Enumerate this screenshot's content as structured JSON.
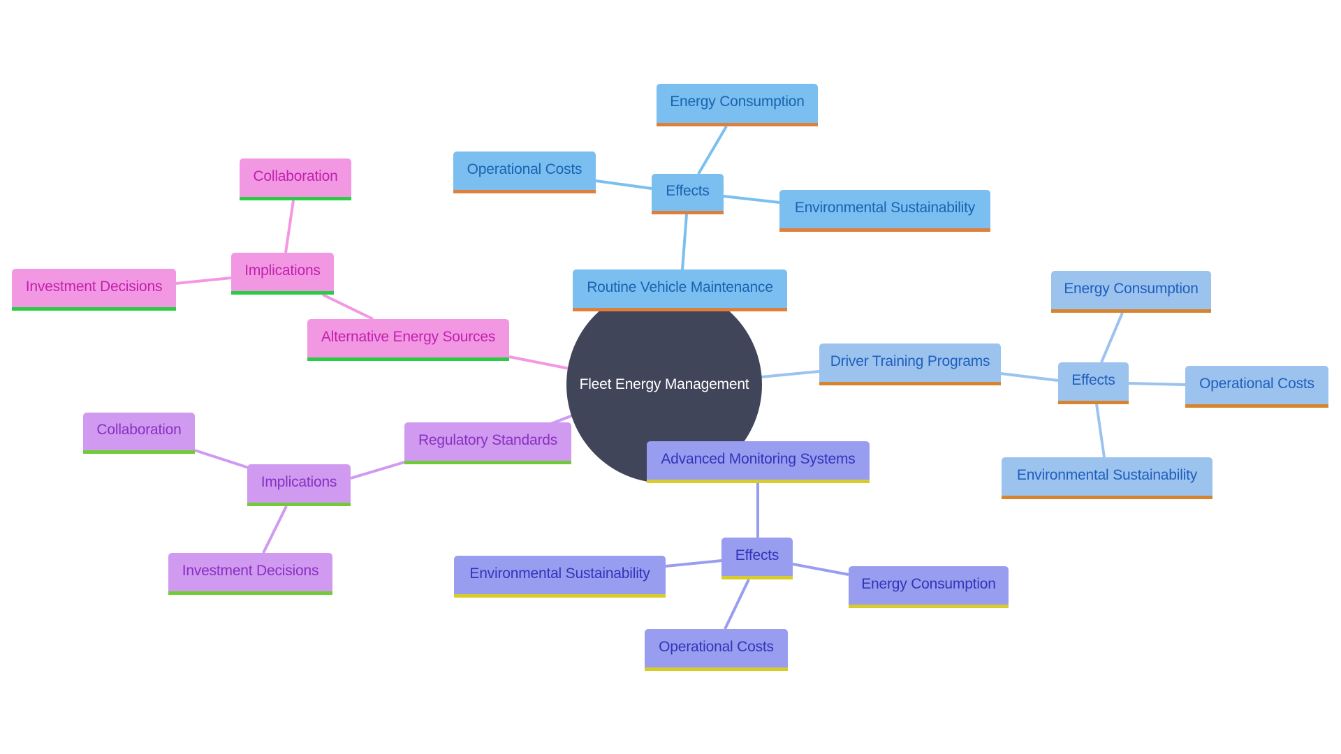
{
  "title": "Fleet Energy Management",
  "colors": {
    "center": "#414559",
    "routine_branch": "#7bbff0",
    "driver_branch": "#9cc2ee",
    "monitoring_branch": "#999df0",
    "alternative_branch": "#f298e3",
    "regulatory_branch": "#cf9af0"
  },
  "branches": {
    "routine": {
      "label": "Routine Vehicle Maintenance",
      "effects_label": "Effects",
      "children": [
        "Energy Consumption",
        "Operational Costs",
        "Environmental Sustainability"
      ]
    },
    "driver": {
      "label": "Driver Training Programs",
      "effects_label": "Effects",
      "children": [
        "Energy Consumption",
        "Operational Costs",
        "Environmental Sustainability"
      ]
    },
    "monitoring": {
      "label": "Advanced Monitoring Systems",
      "effects_label": "Effects",
      "children": [
        "Environmental Sustainability",
        "Energy Consumption",
        "Operational Costs"
      ]
    },
    "alternative": {
      "label": "Alternative Energy Sources",
      "implications_label": "Implications",
      "children": [
        "Collaboration",
        "Investment Decisions"
      ]
    },
    "regulatory": {
      "label": "Regulatory Standards",
      "implications_label": "Implications",
      "children": [
        "Collaboration",
        "Investment Decisions"
      ]
    }
  }
}
